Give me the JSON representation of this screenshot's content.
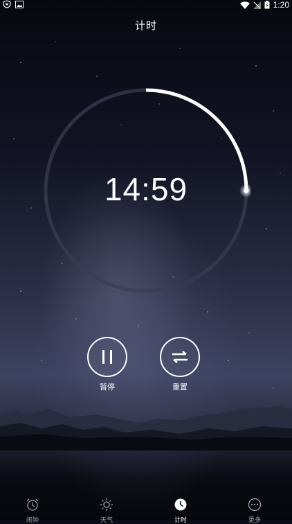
{
  "status_bar": {
    "time": "1:20"
  },
  "header": {
    "title": "计时"
  },
  "timer": {
    "display": "14:59",
    "progress_elapsed_fraction": 0.25
  },
  "controls": {
    "pause_label": "暂停",
    "reset_label": "重置"
  },
  "tabs": [
    {
      "label": "闹钟",
      "icon": "alarm-clock-icon",
      "active": false
    },
    {
      "label": "天气",
      "icon": "sun-icon",
      "active": false
    },
    {
      "label": "计时",
      "icon": "clock-icon",
      "active": true
    },
    {
      "label": "更多",
      "icon": "more-icon",
      "active": false
    }
  ],
  "colors": {
    "accent": "#ffffff",
    "track": "#3a3d52",
    "inactive_tab": "#9aa0ae"
  }
}
